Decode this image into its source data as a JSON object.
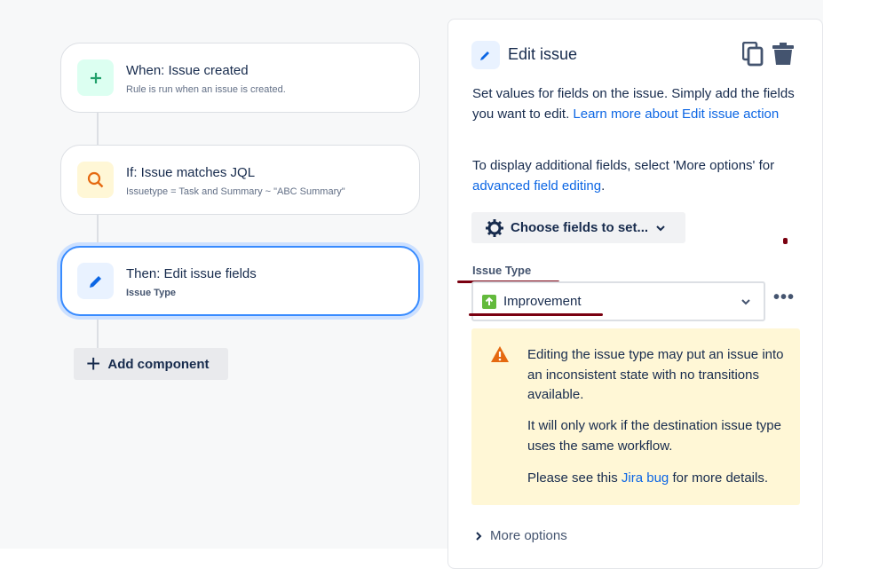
{
  "flow": {
    "cards": [
      {
        "title": "When: Issue created",
        "subtitle": "Rule is run when an issue is created."
      },
      {
        "title": "If: Issue matches JQL",
        "subtitle": "Issuetype = Task and Summary ~ \"ABC Summary\""
      },
      {
        "title": "Then: Edit issue fields",
        "subtitle": "Issue Type"
      }
    ],
    "add_component": "Add component"
  },
  "panel": {
    "title": "Edit issue",
    "desc1": "Set values for fields on the issue. Simply add the fields you want to edit.",
    "desc1_link": "Learn more about Edit issue action",
    "desc2": "To display additional fields, select 'More options' for",
    "desc2_link": "advanced field editing",
    "desc2_end": ".",
    "choose_fields": "Choose fields to set...",
    "field_label": "Issue Type",
    "field_value": "Improvement",
    "warning": {
      "p1": "Editing the issue type may put an issue into an inconsistent state with no transitions available.",
      "p2": "It will only work if the destination issue type uses the same workflow.",
      "p3_pre": "Please see this",
      "p3_link": "Jira bug",
      "p3_post": "for more details."
    },
    "more_options": "More options"
  }
}
